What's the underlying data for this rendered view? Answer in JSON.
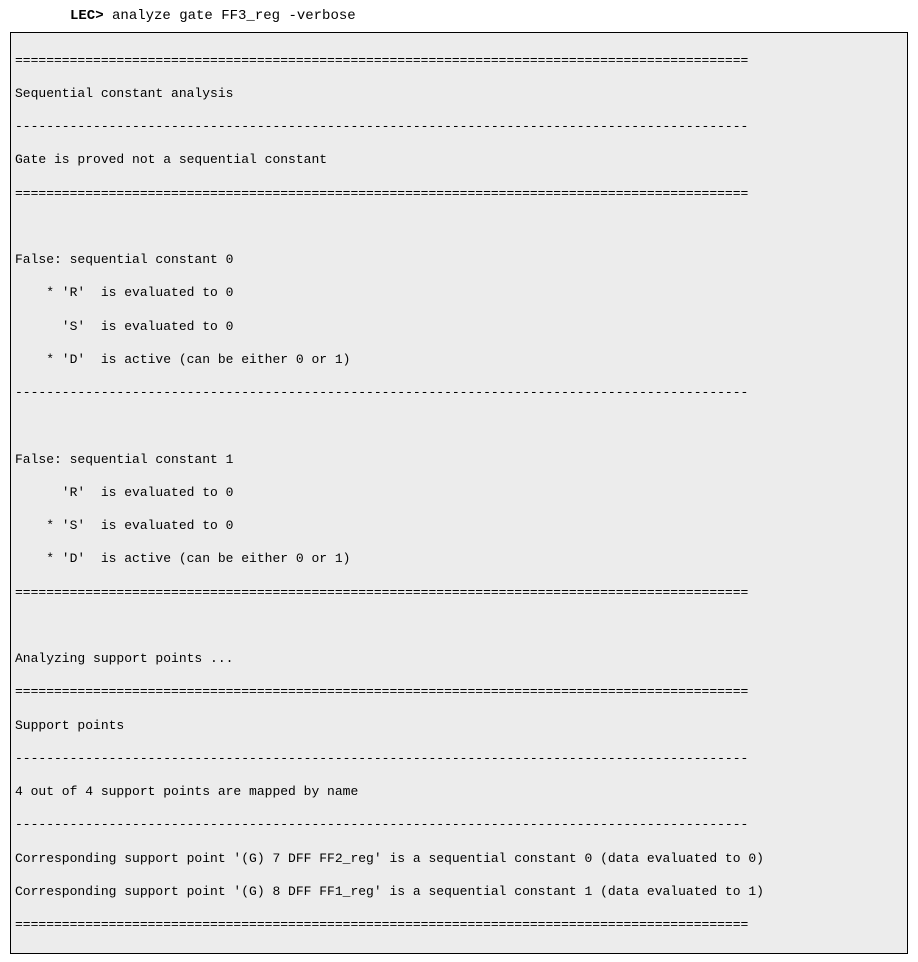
{
  "command": {
    "prompt": "LEC>",
    "text": " analyze gate FF3_reg -verbose"
  },
  "output": {
    "dsep": "==============================================================================================",
    "ssep": "----------------------------------------------------------------------------------------------",
    "header1": "Sequential constant analysis",
    "result": "Gate is proved not a sequential constant",
    "block0": {
      "title": "False: sequential constant 0",
      "l1": "    * 'R'  is evaluated to 0",
      "l2": "      'S'  is evaluated to 0",
      "l3": "    * 'D'  is active (can be either 0 or 1)"
    },
    "block1": {
      "title": "False: sequential constant 1",
      "l1": "      'R'  is evaluated to 0",
      "l2": "    * 'S'  is evaluated to 0",
      "l3": "    * 'D'  is active (can be either 0 or 1)"
    },
    "analyzing": "Analyzing support points ...",
    "support_header": "Support points",
    "mapped": "4 out of 4 support points are mapped by name",
    "sp0": "Corresponding support point '(G) 7 DFF FF2_reg' is a sequential constant 0 (data evaluated to 0)",
    "sp1": "Corresponding support point '(G) 8 DFF FF1_reg' is a sequential constant 1 (data evaluated to 1)"
  }
}
